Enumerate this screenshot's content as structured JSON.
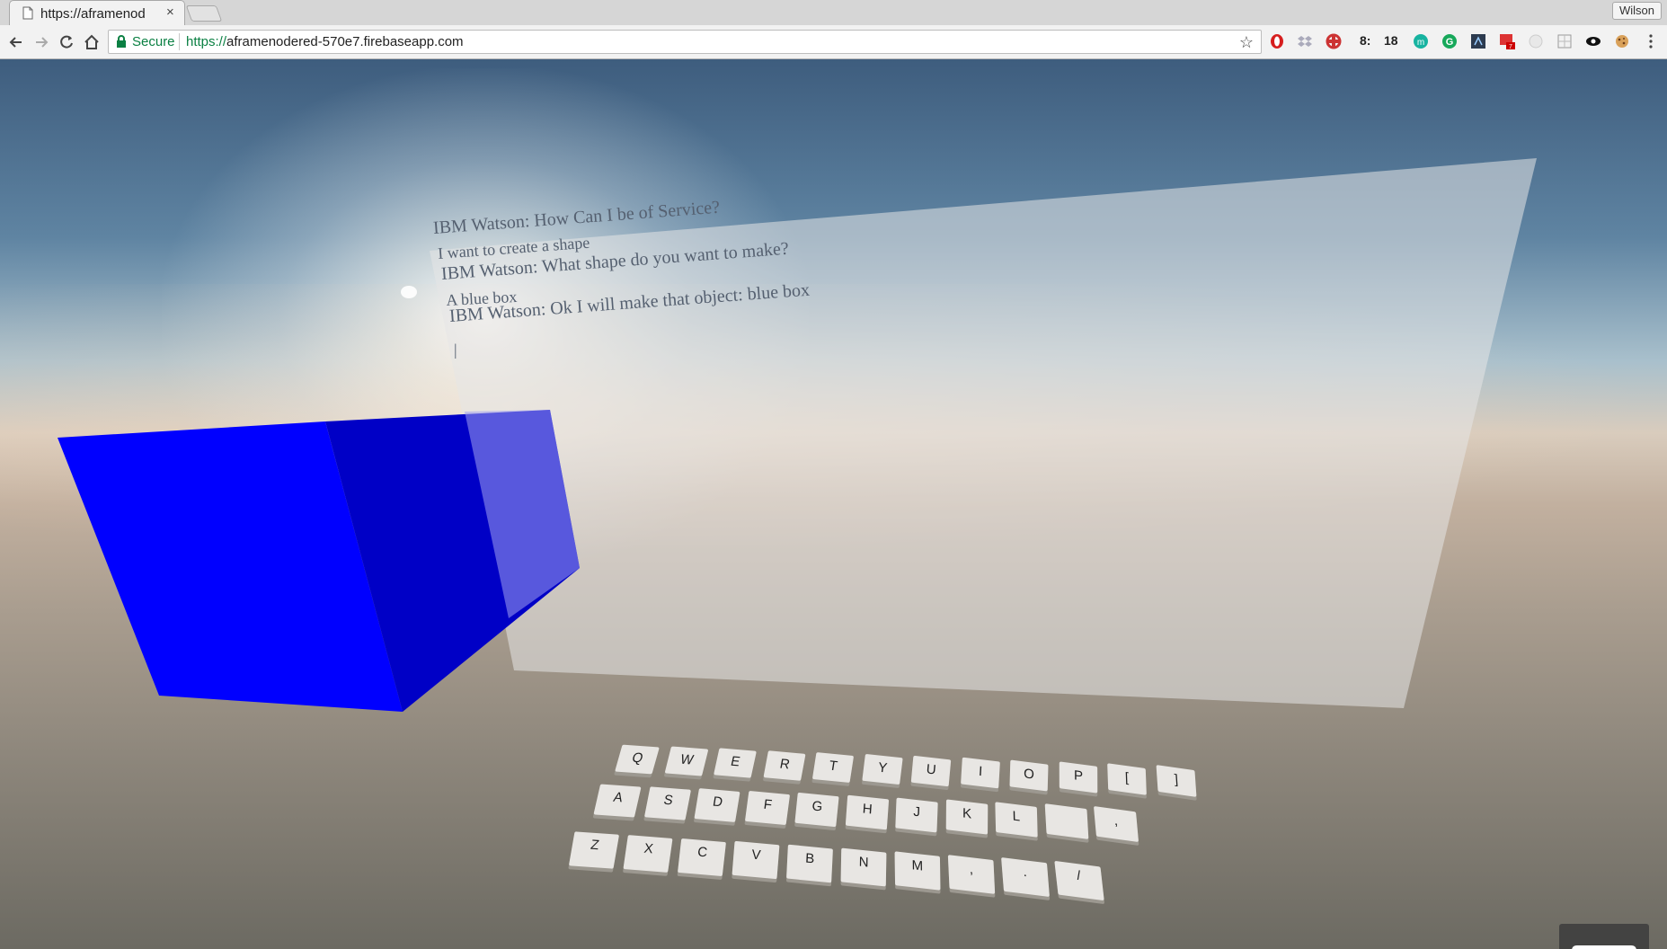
{
  "browser": {
    "tab_title": "https://aframenod",
    "tab_close": "×",
    "profile_name": "Wilson",
    "address": {
      "secure_label": "Secure",
      "url_scheme": "https://",
      "url_host": "aframenodered-570e7.firebaseapp.com"
    },
    "extensions": [
      "opera-icon",
      "dropbox-icon",
      "lifesaver-icon",
      "timer-8",
      "timer-18",
      "m-icon",
      "grammarly-icon",
      "dark-square-icon",
      "badge-icon",
      "circle-icon",
      "grid-icon",
      "eye-icon",
      "cookie-icon",
      "menu-icon"
    ],
    "ext_text_1": "8:",
    "ext_text_2": "18",
    "badge_count": "7"
  },
  "scene": {
    "chat_lines": [
      "IBM Watson: How Can I be of Service?",
      "I want to create a shape",
      "IBM Watson: What shape do you want to make?",
      "A blue box",
      "IBM Watson: Ok I will make that object: blue box",
      "|"
    ],
    "box_color": "#0000ff",
    "keyboard": {
      "row1": [
        "Q",
        "W",
        "E",
        "R",
        "T",
        "Y",
        "U",
        "I",
        "O",
        "P",
        "[",
        "]"
      ],
      "row2": [
        "A",
        "S",
        "D",
        "F",
        "G",
        "H",
        "J",
        "K",
        "L",
        "",
        ","
      ],
      "row3": [
        "Z",
        "X",
        "C",
        "V",
        "B",
        "N",
        "M",
        ",",
        ".",
        "/"
      ]
    },
    "vr_button": "vr-headset-icon"
  }
}
